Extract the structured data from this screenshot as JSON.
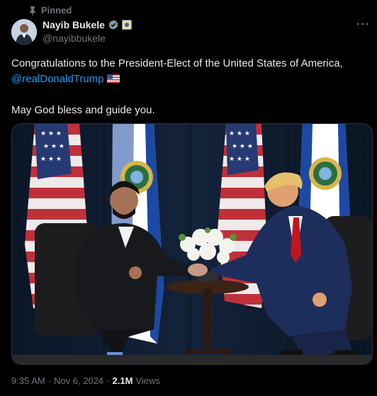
{
  "pinned": {
    "label": "Pinned"
  },
  "author": {
    "display_name": "Nayib Bukele",
    "handle": "@nayibbukele"
  },
  "tweet": {
    "line1": "Congratulations to the President-Elect of the United States of America,",
    "mention": "@realDonaldTrump",
    "line2": "May God bless and guide you."
  },
  "meta": {
    "time": "9:35 AM",
    "sep1": "·",
    "date": "Nov 6, 2024",
    "sep2": "·",
    "views_count": "2.1M",
    "views_label": "Views"
  },
  "colors": {
    "accent": "#1d9bf0",
    "muted": "#71767b",
    "text": "#e7e9ea",
    "background": "#000000"
  },
  "icons": {
    "pin": "pin-icon",
    "verified": "verified-badge-icon",
    "affiliation": "affiliation-badge-icon",
    "more": "more-options-icon",
    "flag": "us-flag-icon"
  }
}
